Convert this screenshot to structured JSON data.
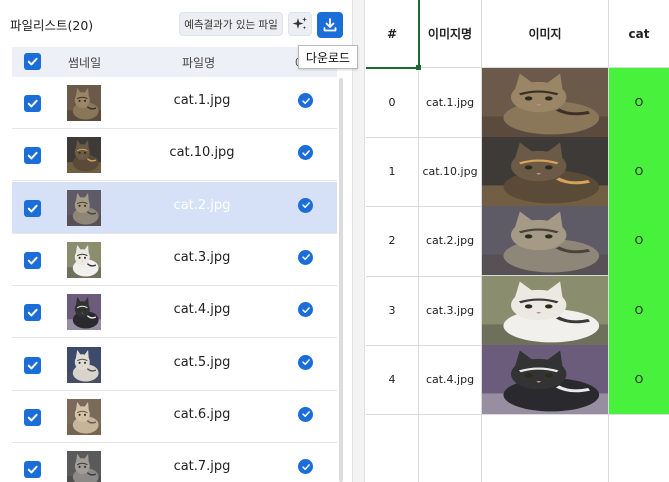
{
  "left_panel": {
    "title": "파일리스트(20)",
    "predict_button": "예측결과가 있는 파일",
    "download_tooltip": "다운로드",
    "header": {
      "thumbnail": "썸네일",
      "filename": "파일명",
      "result": "예"
    },
    "rows": [
      {
        "filename": "cat.1.jpg",
        "checked": true,
        "selected": false
      },
      {
        "filename": "cat.10.jpg",
        "checked": true,
        "selected": false
      },
      {
        "filename": "cat.2.jpg",
        "checked": true,
        "selected": true
      },
      {
        "filename": "cat.3.jpg",
        "checked": true,
        "selected": false
      },
      {
        "filename": "cat.4.jpg",
        "checked": true,
        "selected": false
      },
      {
        "filename": "cat.5.jpg",
        "checked": true,
        "selected": false
      },
      {
        "filename": "cat.6.jpg",
        "checked": true,
        "selected": false
      },
      {
        "filename": "cat.7.jpg",
        "checked": true,
        "selected": false
      }
    ]
  },
  "grid": {
    "headers": {
      "index": "#",
      "name": "이미지명",
      "image": "이미지",
      "cat": "cat"
    },
    "rows": [
      {
        "index": "0",
        "name": "cat.1.jpg",
        "cat": "O"
      },
      {
        "index": "1",
        "name": "cat.10.jpg",
        "cat": "O"
      },
      {
        "index": "2",
        "name": "cat.2.jpg",
        "cat": "O"
      },
      {
        "index": "3",
        "name": "cat.3.jpg",
        "cat": "O"
      },
      {
        "index": "4",
        "name": "cat.4.jpg",
        "cat": "O"
      }
    ]
  },
  "colors": {
    "accent": "#1b6ed8",
    "selected_row": "#d6e1f7",
    "cat_cell": "#48f23c"
  },
  "icons": {
    "sparkle": "sparkle-icon",
    "download": "download-icon",
    "check": "check-icon",
    "status": "check-circle-icon"
  }
}
